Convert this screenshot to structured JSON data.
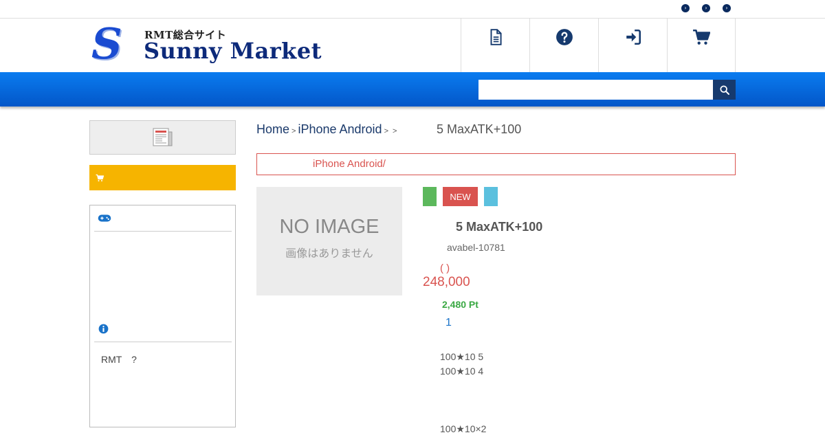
{
  "topbar": {
    "links": [
      "",
      "",
      ""
    ]
  },
  "logo": {
    "small_text": "RMT総合サイト",
    "brand": "Sunny Market",
    "mark": "S"
  },
  "header_nav": [
    {
      "icon": "document-icon"
    },
    {
      "icon": "question-icon"
    },
    {
      "icon": "login-icon"
    },
    {
      "icon": "cart-icon"
    }
  ],
  "search": {
    "placeholder": "",
    "value": ""
  },
  "sidebar": {
    "rmt_text": "RMT　?"
  },
  "breadcrumb": {
    "home": "Home",
    "category": "iPhone  Android",
    "sep1": ">",
    "sep2": ">",
    "sep3": ">",
    "current": "5 MaxATK+100"
  },
  "notice": {
    "text": "iPhone  Android/"
  },
  "product": {
    "noimage_title": "NO IMAGE",
    "noimage_sub": "画像はありません",
    "badge_new": "NEW",
    "title": "5 MaxATK+100",
    "code": "avabel-10781",
    "paren": "(  )",
    "price": "248,000",
    "points": "2,480 Pt",
    "quantity": "1",
    "detail_lines": [
      "100★10   5",
      "100★10   4",
      "100★10×2"
    ]
  },
  "colors": {
    "brand_blue": "#0a6ee0",
    "navy": "#163a6e",
    "cart_yellow": "#f6b400",
    "price_red": "#d9534f",
    "points_green": "#3aa843"
  }
}
